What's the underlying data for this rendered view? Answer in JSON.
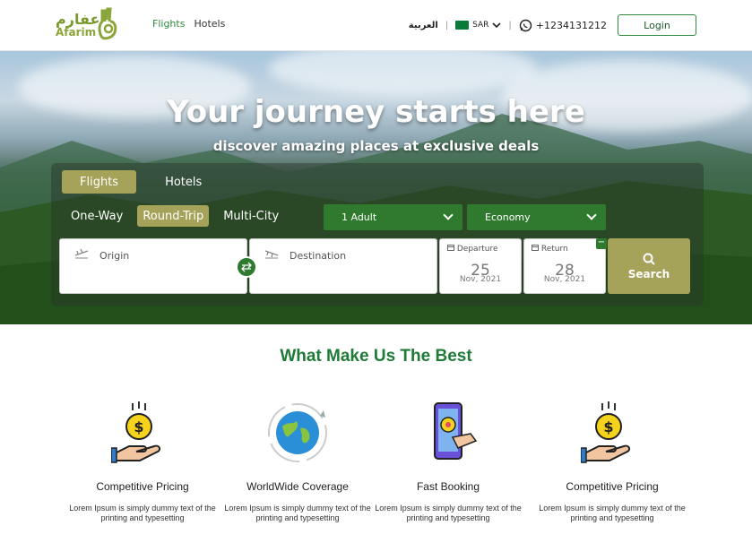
{
  "nav": {
    "logo_ar": "عفارم",
    "logo_en": "Afarim",
    "links": [
      "Flights",
      "Hotels"
    ],
    "language": "العربية",
    "currency": "SAR",
    "phone": "+1234131212",
    "login": "Login"
  },
  "hero": {
    "title": "Your journey starts here",
    "subtitle": "discover amazing places at exclusive deals"
  },
  "search": {
    "tabs": [
      "Flights",
      "Hotels"
    ],
    "trip_types": [
      "One-Way",
      "Round-Trip",
      "Multi-City"
    ],
    "passengers": "1 Adult",
    "cabin": "Economy",
    "origin_placeholder": "Origin",
    "destination_placeholder": "Destination",
    "departure_label": "Departure",
    "departure_day": "25",
    "departure_month": "Nov, 2021",
    "return_label": "Return",
    "return_day": "28",
    "return_month": "Nov, 2021",
    "return_remove": "−",
    "button": "Search"
  },
  "best": {
    "title": "What Make Us The Best",
    "features": [
      {
        "title": "Competitive Pricing",
        "desc": "Lorem Ipsum is simply dummy text of the printing and typesetting"
      },
      {
        "title": "WorldWide Coverage",
        "desc": "Lorem Ipsum is simply dummy text of the printing and typesetting"
      },
      {
        "title": "Fast Booking",
        "desc": "Lorem Ipsum is simply dummy text of the printing and typesetting"
      },
      {
        "title": "Competitive Pricing",
        "desc": "Lorem Ipsum is simply dummy text of the printing and typesetting"
      }
    ]
  },
  "colors": {
    "brand_green": "#1e7a36",
    "accent_olive": "#a5a35a"
  }
}
